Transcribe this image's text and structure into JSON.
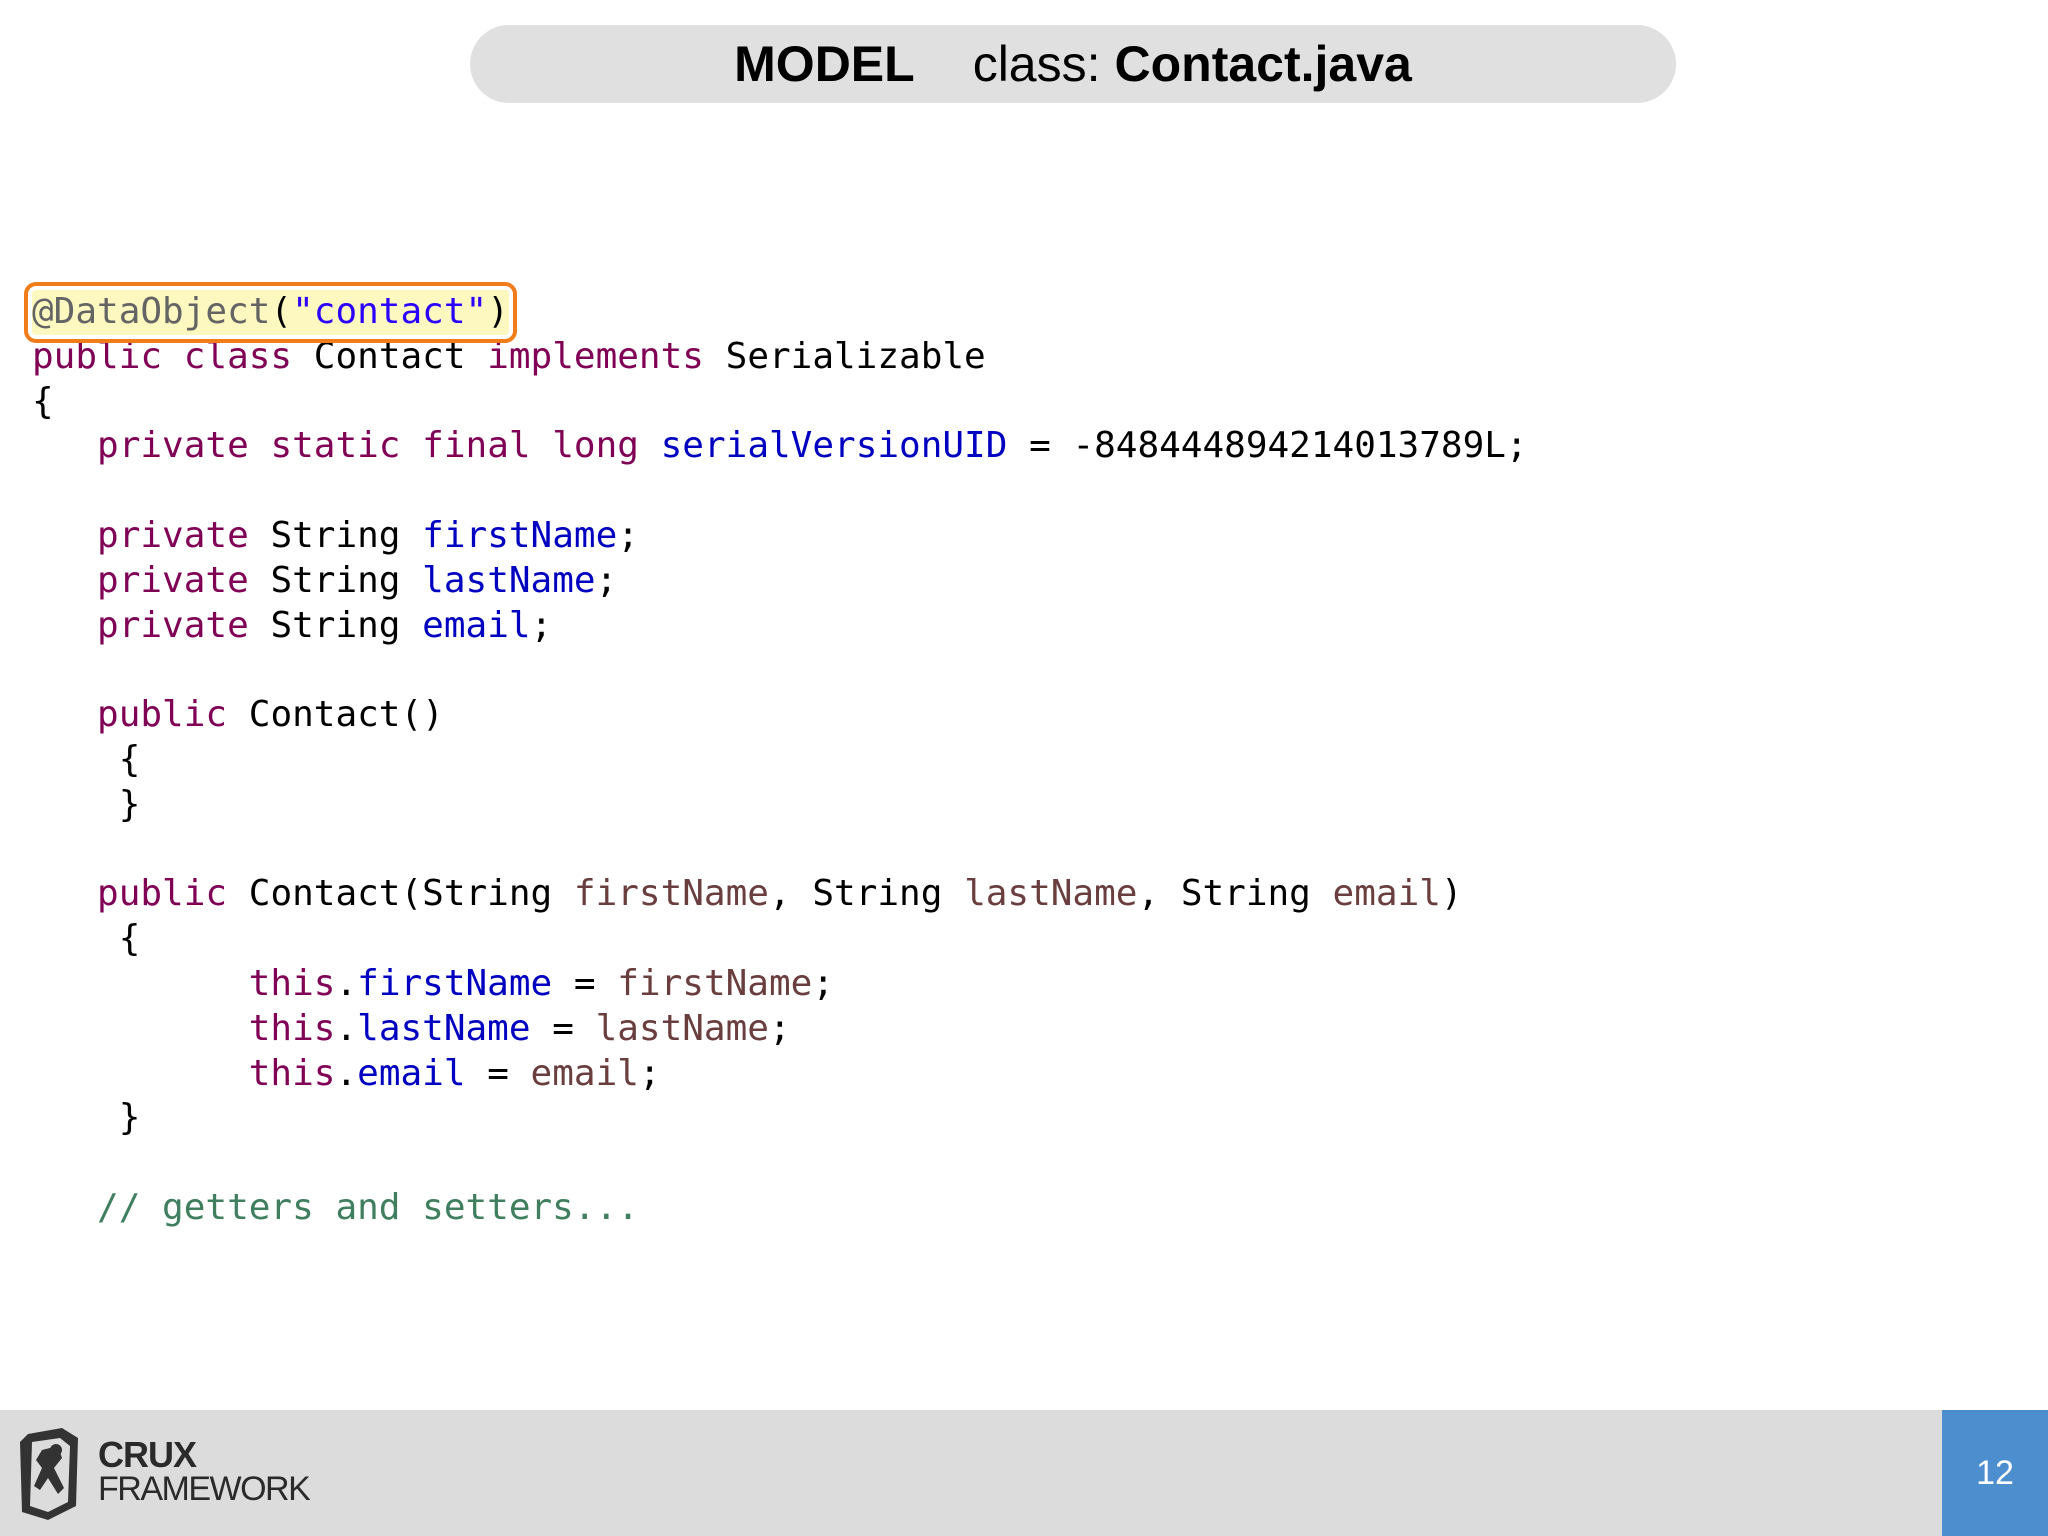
{
  "title": {
    "model": "MODEL",
    "class_label": "class:",
    "file": "Contact.java"
  },
  "code": {
    "annotation": "@DataObject",
    "annotation_open": "(",
    "annotation_value": "\"contact\"",
    "annotation_close": ")",
    "kw_public": "public",
    "kw_class": "class",
    "kw_implements": "implements",
    "kw_private": "private",
    "kw_static": "static",
    "kw_final": "final",
    "kw_long": "long",
    "kw_this": "this",
    "class_name": "Contact",
    "interface_name": "Serializable",
    "type_string": "String",
    "serial_field": "serialVersionUID",
    "serial_value": "-848444894214013789L",
    "field_first": "firstName",
    "field_last": "lastName",
    "field_email": "email",
    "ctor_empty": "Contact()",
    "ctor_args": "Contact(",
    "comment": "// getters and setters..."
  },
  "footer": {
    "logo_line1": "CRUX",
    "logo_line2": "FRAMEWORK",
    "page_number": "12"
  }
}
